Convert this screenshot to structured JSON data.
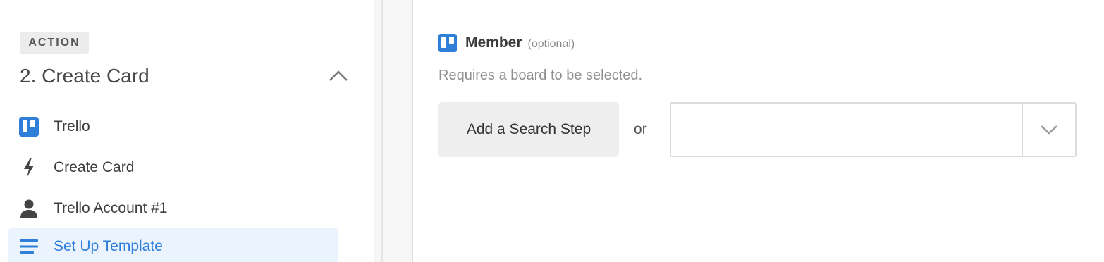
{
  "sidebar": {
    "badge": "ACTION",
    "step_title": "2. Create Card",
    "items": [
      {
        "label": "Trello",
        "icon": "trello-icon"
      },
      {
        "label": "Create Card",
        "icon": "bolt-icon"
      },
      {
        "label": "Trello Account #1",
        "icon": "user-icon"
      },
      {
        "label": "Set Up Template",
        "icon": "list-icon",
        "active": true
      }
    ]
  },
  "field": {
    "label": "Member",
    "optional": "(optional)",
    "help": "Requires a board to be selected.",
    "search_button": "Add a Search Step",
    "or": "or",
    "select_value": ""
  },
  "colors": {
    "trello_blue": "#2f7fd8",
    "active_bg": "#eaf3fe"
  }
}
